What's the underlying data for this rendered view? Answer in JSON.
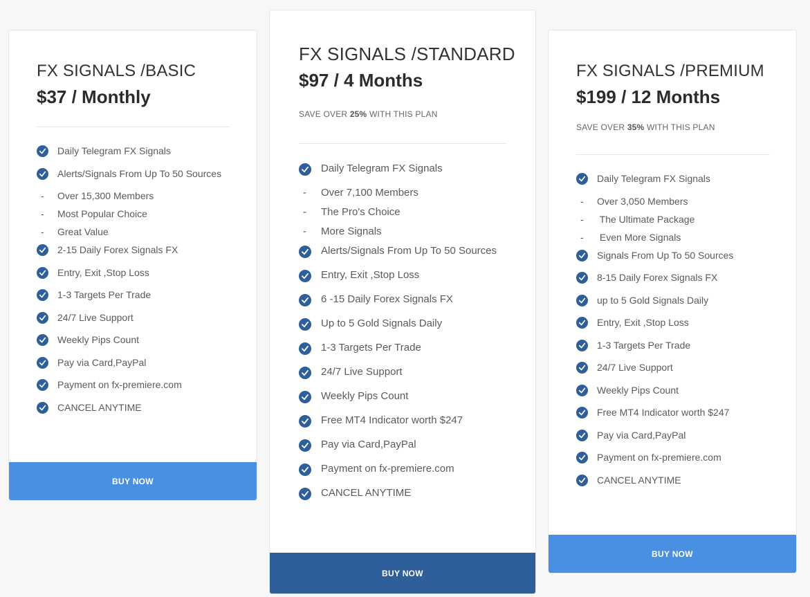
{
  "colors": {
    "accent_light": "#4a90e2",
    "accent_dark": "#2f5f9a",
    "check": "#2f5f9a"
  },
  "plans": [
    {
      "id": "basic",
      "title": "FX SIGNALS /BASIC",
      "price": "$37 / Monthly",
      "save": null,
      "button_label": "BUY NOW",
      "features": [
        {
          "type": "check",
          "text": "Daily Telegram FX Signals"
        },
        {
          "type": "check",
          "text": "Alerts/Signals From Up To 50 Sources"
        },
        {
          "type": "dash",
          "text": "Over 15,300 Members"
        },
        {
          "type": "dash",
          "text": "Most Popular Choice"
        },
        {
          "type": "dash",
          "text": "Great Value"
        },
        {
          "type": "check",
          "text": "2-15 Daily Forex Signals FX"
        },
        {
          "type": "check",
          "text": "Entry, Exit ,Stop Loss"
        },
        {
          "type": "check",
          "text": "1-3 Targets Per Trade"
        },
        {
          "type": "check",
          "text": "24/7 Live Support"
        },
        {
          "type": "check",
          "text": "Weekly Pips Count"
        },
        {
          "type": "check",
          "text": "Pay via Card,PayPal"
        },
        {
          "type": "check",
          "text": "Payment on fx-premiere.com"
        },
        {
          "type": "check",
          "text": "CANCEL ANYTIME"
        }
      ]
    },
    {
      "id": "standard",
      "title": "FX SIGNALS /STANDARD",
      "price": "$97 / 4 Months",
      "save": {
        "prefix": "SAVE OVER ",
        "value": "25%",
        "suffix": " WITH THIS PLAN"
      },
      "button_label": "BUY NOW",
      "features": [
        {
          "type": "check",
          "text": "Daily Telegram FX Signals"
        },
        {
          "type": "dash",
          "text": "Over 7,100 Members"
        },
        {
          "type": "dash",
          "text": "The Pro's Choice"
        },
        {
          "type": "dash",
          "text": "More Signals"
        },
        {
          "type": "check",
          "text": "Alerts/Signals From Up To 50 Sources"
        },
        {
          "type": "check",
          "text": "Entry, Exit ,Stop Loss"
        },
        {
          "type": "check",
          "text": "6 -15 Daily Forex Signals FX"
        },
        {
          "type": "check",
          "text": "Up to 5 Gold Signals Daily"
        },
        {
          "type": "check",
          "text": "1-3 Targets Per Trade"
        },
        {
          "type": "check",
          "text": "24/7 Live Support"
        },
        {
          "type": "check",
          "text": "Weekly Pips Count"
        },
        {
          "type": "check",
          "text": "Free MT4 Indicator worth $247"
        },
        {
          "type": "check",
          "text": "Pay via Card,PayPal"
        },
        {
          "type": "check",
          "text": "Payment on fx-premiere.com"
        },
        {
          "type": "check",
          "text": "CANCEL ANYTIME"
        }
      ]
    },
    {
      "id": "premium",
      "title": "FX SIGNALS /PREMIUM",
      "price": "$199 / 12 Months",
      "save": {
        "prefix": "SAVE OVER ",
        "value": "35%",
        "suffix": " WITH THIS PLAN"
      },
      "button_label": "BUY NOW",
      "features": [
        {
          "type": "check",
          "text": "Daily Telegram FX Signals"
        },
        {
          "type": "dash",
          "text": "Over 3,050 Members"
        },
        {
          "type": "dash",
          "text": " The Ultimate Package"
        },
        {
          "type": "dash",
          "text": " Even More Signals"
        },
        {
          "type": "check",
          "text": "Signals From Up To 50 Sources"
        },
        {
          "type": "check",
          "text": "8-15 Daily Forex Signals FX"
        },
        {
          "type": "check",
          "text": "up to 5 Gold Signals Daily"
        },
        {
          "type": "check",
          "text": "Entry, Exit ,Stop Loss"
        },
        {
          "type": "check",
          "text": "1-3 Targets Per Trade"
        },
        {
          "type": "check",
          "text": "24/7 Live Support"
        },
        {
          "type": "check",
          "text": "Weekly Pips Count"
        },
        {
          "type": "check",
          "text": "Free MT4 Indicator worth $247"
        },
        {
          "type": "check",
          "text": "Pay via Card,PayPal"
        },
        {
          "type": "check",
          "text": "Payment on fx-premiere.com"
        },
        {
          "type": "check",
          "text": "CANCEL ANYTIME"
        }
      ]
    }
  ]
}
